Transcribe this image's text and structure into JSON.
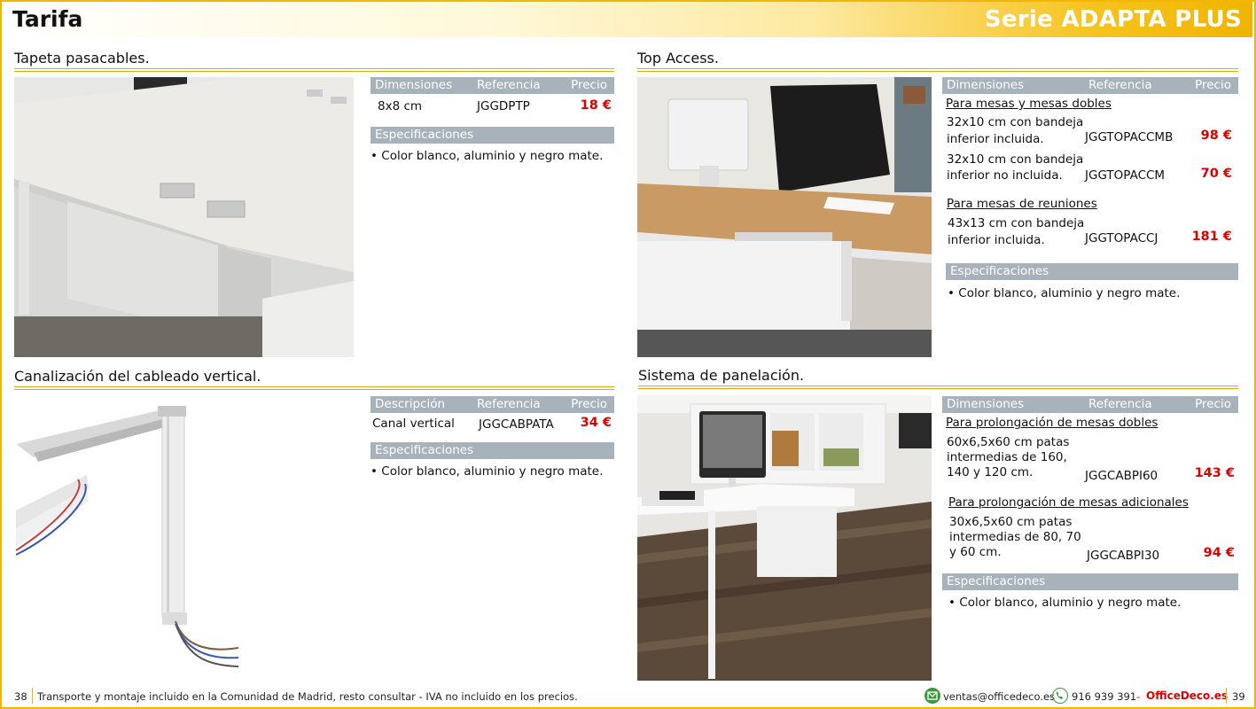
{
  "header": {
    "title": "Tarifa",
    "series": "Serie ADAPTA PLUS"
  },
  "sections": {
    "tapeta": {
      "title": "Tapeta pasacables.",
      "head": {
        "c1": "Dimensiones",
        "c2": "Referencia",
        "c3": "Precio"
      },
      "row": {
        "dim": "8x8 cm",
        "ref": "JGGDPTP",
        "price": "18 €"
      },
      "spec_head": "Especificaciones",
      "spec": "Color blanco, aluminio y negro mate."
    },
    "top_access": {
      "title": "Top Access.",
      "head": {
        "c1": "Dimensiones",
        "c2": "Referencia",
        "c3": "Precio"
      },
      "group1": "Para mesas y mesas dobles",
      "r1": {
        "l1": "32x10 cm con bandeja",
        "l2": "inferior incluida.",
        "ref": "JGGTOPACCMB",
        "price": "98 €"
      },
      "r2": {
        "l1": "32x10 cm con bandeja",
        "l2": "inferior no incluida.",
        "ref": "JGGTOPACCM",
        "price": "70 €"
      },
      "group2": "Para mesas de reuniones",
      "r3": {
        "l1": "43x13 cm con bandeja",
        "l2": "inferior incluida.",
        "ref": "JGGTOPACCJ",
        "price": "181 €"
      },
      "spec_head": "Especificaciones",
      "spec": "Color blanco, aluminio y negro mate."
    },
    "canal": {
      "title": "Canalización del cableado vertical.",
      "head": {
        "c1": "Descripción",
        "c2": "Referencia",
        "c3": "Precio"
      },
      "row": {
        "desc": "Canal vertical",
        "ref": "JGGCABPATA",
        "price": "34 €"
      },
      "spec_head": "Especificaciones",
      "spec": "Color blanco, aluminio y negro mate."
    },
    "panel": {
      "title": "Sistema de panelación.",
      "head": {
        "c1": "Dimensiones",
        "c2": "Referencia",
        "c3": "Precio"
      },
      "group1": "Para prolongación de mesas dobles",
      "r1": {
        "l1": "60x6,5x60 cm patas",
        "l2": "intermedias de 160,",
        "l3": "140 y 120 cm.",
        "ref": "JGGCABPI60",
        "price": "143 €"
      },
      "group2": "Para prolongación de mesas adicionales",
      "r2": {
        "l1": "30x6,5x60 cm patas",
        "l2": "intermedias de 80, 70",
        "l3": "y 60 cm.",
        "ref": "JGGCABPI30",
        "price": "94 €"
      },
      "spec_head": "Especificaciones",
      "spec": "Color blanco, aluminio y negro mate."
    }
  },
  "footer": {
    "page_left": "38",
    "note": "Transporte y montaje incluido en la Comunidad de Madrid, resto consultar - IVA no incluido en los precios.",
    "email": "ventas@officedeco.es",
    "phone": "916 939 391",
    "sep": "-",
    "brand": "OfficeDeco.es",
    "page_right": "39"
  },
  "colors": {
    "accent": "#f0b400",
    "table_head": "#a8b2ba",
    "price": "#dd0000"
  }
}
